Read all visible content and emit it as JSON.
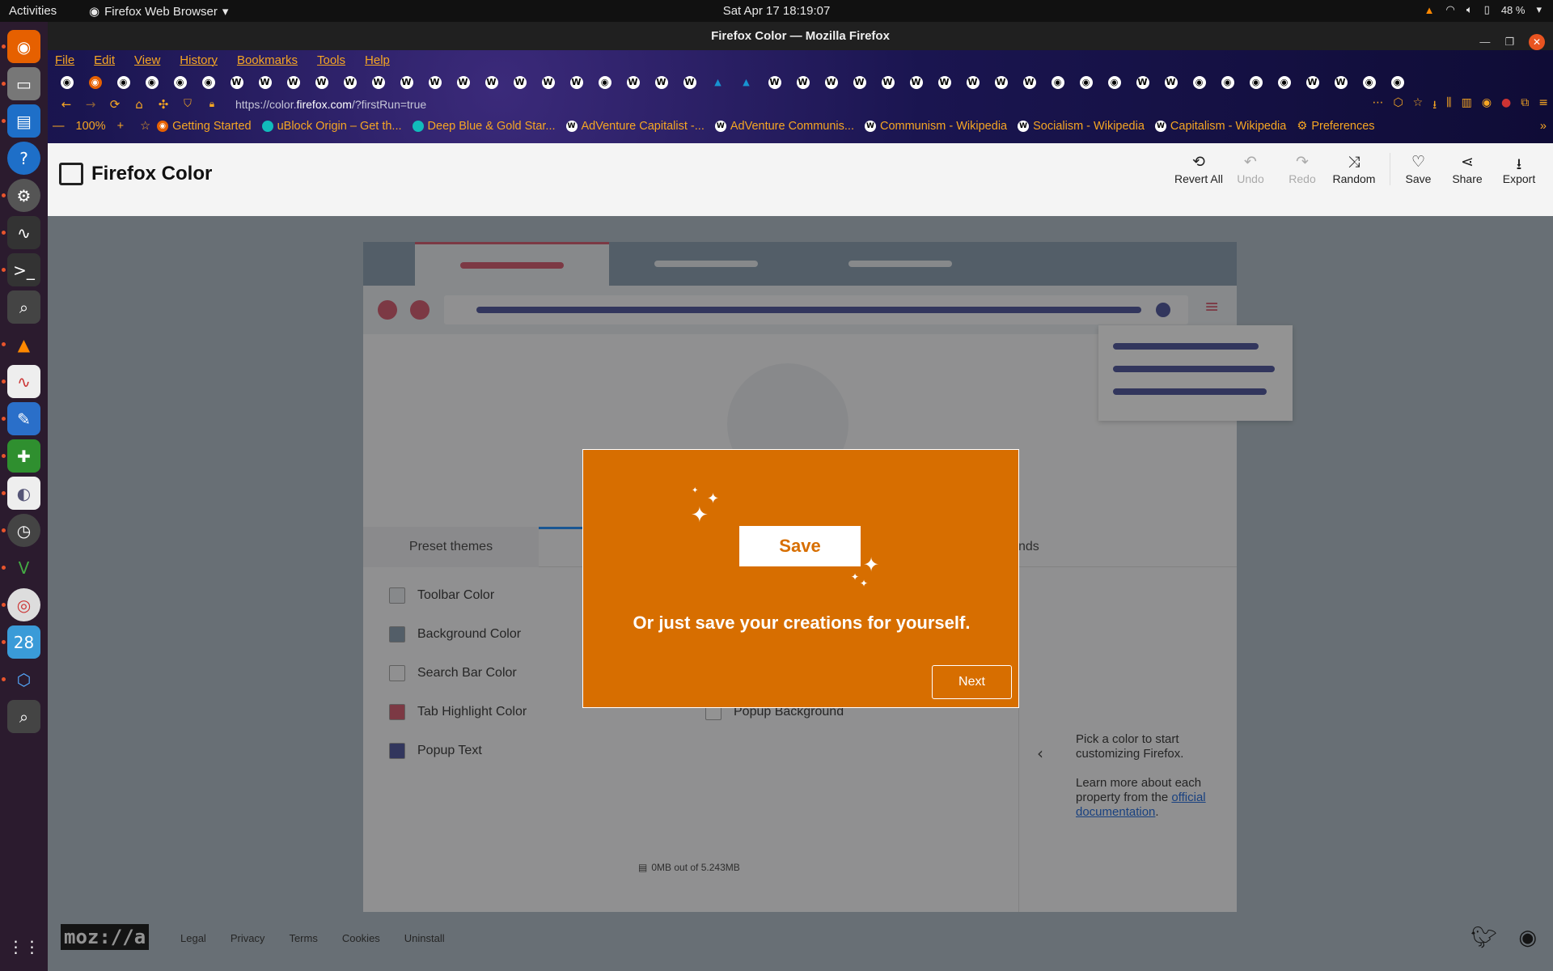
{
  "topbar": {
    "activities": "Activities",
    "app_menu": "Firefox Web Browser",
    "clock": "Sat Apr 17  18:19:07",
    "battery": "48 %"
  },
  "window": {
    "title": "Firefox Color — Mozilla Firefox"
  },
  "menubar": [
    "File",
    "Edit",
    "View",
    "History",
    "Bookmarks",
    "Tools",
    "Help"
  ],
  "tabs": {
    "favicons": [
      "github",
      "firefox",
      "github",
      "github",
      "github",
      "github",
      "wikipedia",
      "wikipedia",
      "wikipedia",
      "wikipedia",
      "wikipedia",
      "wikipedia",
      "wikipedia",
      "wikipedia",
      "wikipedia",
      "wikipedia",
      "wikipedia",
      "wikipedia",
      "wikipedia",
      "github",
      "wikipedia",
      "wikipedia",
      "wikipedia",
      "arch",
      "arch",
      "wikipedia",
      "wikipedia",
      "wikipedia",
      "wikipedia",
      "wikipedia",
      "wikipedia",
      "wikipedia",
      "wikipedia",
      "wikipedia",
      "wikipedia",
      "github",
      "github",
      "github",
      "wikipedia",
      "wikipedia",
      "github",
      "github",
      "github",
      "github",
      "wikipedia",
      "wikipedia",
      "github",
      "github"
    ]
  },
  "navbar": {
    "url_prefix": "https://color.",
    "url_domain": "firefox.com",
    "url_suffix": "/?firstRun=true"
  },
  "bookmarks": {
    "zoom": "100%",
    "items": [
      "Getting Started",
      "uBlock Origin – Get th...",
      "Deep Blue & Gold Star...",
      "AdVenture Capitalist -...",
      "AdVenture Communis...",
      "Communism - Wikipedia",
      "Socialism - Wikipedia",
      "Capitalism - Wikipedia",
      "Preferences"
    ]
  },
  "app": {
    "title": "Firefox Color",
    "tools": [
      {
        "label": "Revert All",
        "icon": "revert-icon",
        "glyph": "⟲",
        "enabled": true
      },
      {
        "label": "Undo",
        "icon": "undo-icon",
        "glyph": "↶",
        "enabled": false
      },
      {
        "label": "Redo",
        "icon": "redo-icon",
        "glyph": "↷",
        "enabled": false
      },
      {
        "label": "Random",
        "icon": "shuffle-icon",
        "glyph": "⤨",
        "enabled": true
      },
      {
        "label": "Save",
        "icon": "heart-icon",
        "glyph": "♡",
        "enabled": true
      },
      {
        "label": "Share",
        "icon": "share-icon",
        "glyph": "⋖",
        "enabled": true
      },
      {
        "label": "Export",
        "icon": "download-icon",
        "glyph": "⭳",
        "enabled": true
      }
    ]
  },
  "panel": {
    "tab_preset": "Preset themes",
    "tab_partial": "nds",
    "properties_left": [
      "Toolbar Color",
      "Background Color",
      "Search Bar Color",
      "Tab Highlight Color",
      "Popup Text"
    ],
    "properties_right_visible": [
      "Popup Background"
    ],
    "side_text_1": "Pick a color to start customizing Firefox.",
    "side_text_2": "Learn more about each property from the",
    "side_link": "official documentation",
    "storage": "0MB out of 5.243MB"
  },
  "modal": {
    "button": "Save",
    "message": "Or just save your creations for yourself.",
    "next": "Next"
  },
  "footer": {
    "logo": "moz://a",
    "links": [
      "Legal",
      "Privacy",
      "Terms",
      "Cookies",
      "Uninstall"
    ]
  },
  "colors": {
    "modal_bg": "#d76e00",
    "tab_highlight": "#d04a60",
    "popup_text": "#3d4593",
    "toolbar": "#e6ebef",
    "background": "#7f95a9"
  }
}
